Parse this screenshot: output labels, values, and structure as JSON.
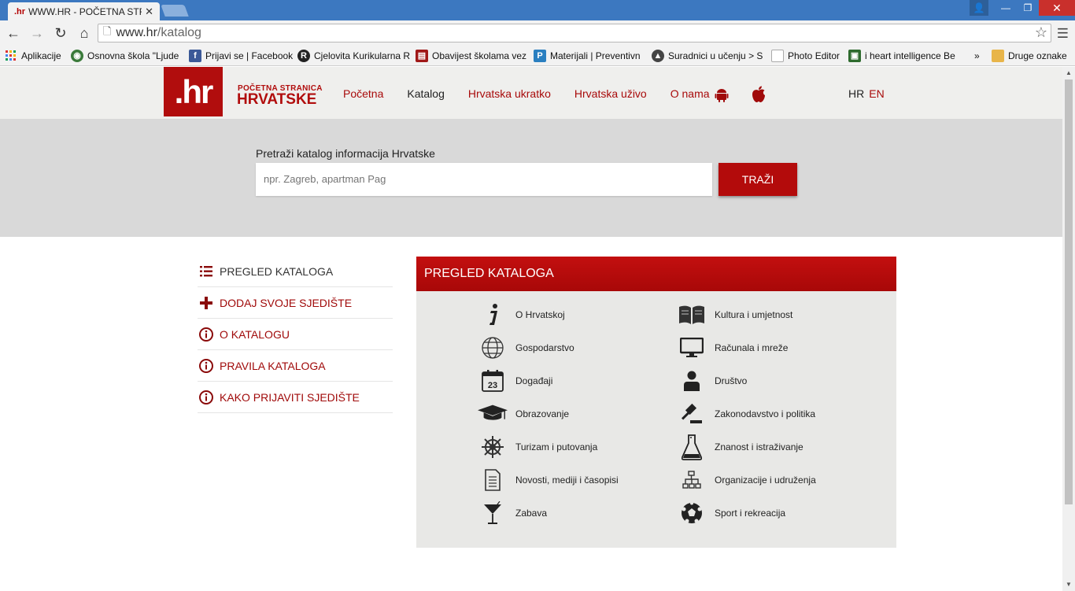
{
  "browser": {
    "tab_title": "WWW.HR - POČETNA STR",
    "tab_favicon": ".hr",
    "url_host": "www.hr",
    "url_path": "/katalog",
    "bookmarks": [
      {
        "label": "Aplikacije",
        "icon": "apps-grid-icon",
        "color": "#2b6ec8"
      },
      {
        "label": "Osnovna škola \"Ljude",
        "icon": "shield-icon",
        "color": "#3a7a3a"
      },
      {
        "label": "Prijavi se | Facebook",
        "icon": "facebook-icon",
        "color": "#3b5998"
      },
      {
        "label": "Cjelovita Kurikularna R",
        "icon": "r-logo-icon",
        "color": "#222222"
      },
      {
        "label": "Obavijest školama vez",
        "icon": "document-red-icon",
        "color": "#a01818"
      },
      {
        "label": "Materijali | Preventivn",
        "icon": "p-logo-icon",
        "color": "#2a7fc0"
      },
      {
        "label": "Suradnici u učenju > S",
        "icon": "graduation-icon",
        "color": "#444444"
      },
      {
        "label": "Photo Editor",
        "icon": "page-icon",
        "color": "#888888"
      },
      {
        "label": "i heart intelligence Be",
        "icon": "image-icon",
        "color": "#2e6b2e"
      }
    ],
    "more_bookmarks": "»",
    "other_bookmarks": "Druge oznake"
  },
  "header": {
    "logo_text": ".hr",
    "logo_small": "POČETNA STRANICA",
    "logo_big": "HRVATSKE",
    "nav": [
      "Početna",
      "Katalog",
      "Hrvatska ukratko",
      "Hrvatska uživo",
      "O nama"
    ],
    "lang_hr": "HR",
    "lang_en": "EN"
  },
  "search": {
    "label": "Pretraži katalog informacija Hrvatske",
    "placeholder": "npr. Zagreb, apartman Pag",
    "button": "TRAŽI"
  },
  "sidemenu": [
    {
      "label": "PREGLED KATALOGA",
      "icon": "list-icon"
    },
    {
      "label": "DODAJ SVOJE SJEDIŠTE",
      "icon": "plus-icon"
    },
    {
      "label": "O KATALOGU",
      "icon": "info-icon"
    },
    {
      "label": "PRAVILA KATALOGA",
      "icon": "info-icon"
    },
    {
      "label": "KAKO PRIJAVITI SJEDIŠTE",
      "icon": "info-icon"
    }
  ],
  "catalog": {
    "title": "PREGLED KATALOGA",
    "left": [
      {
        "label": "O Hrvatskoj",
        "icon": "info-italic-icon"
      },
      {
        "label": "Gospodarstvo",
        "icon": "globe-icon"
      },
      {
        "label": "Događaji",
        "icon": "calendar-icon",
        "badge": "23"
      },
      {
        "label": "Obrazovanje",
        "icon": "graduation-cap-icon"
      },
      {
        "label": "Turizam i putovanja",
        "icon": "ship-wheel-icon"
      },
      {
        "label": "Novosti, mediji i časopisi",
        "icon": "document-icon"
      },
      {
        "label": "Zabava",
        "icon": "cocktail-icon"
      }
    ],
    "right": [
      {
        "label": "Kultura i umjetnost",
        "icon": "book-icon"
      },
      {
        "label": "Računala i mreže",
        "icon": "monitor-icon"
      },
      {
        "label": "Društvo",
        "icon": "person-icon"
      },
      {
        "label": "Zakonodavstvo i politika",
        "icon": "gavel-icon"
      },
      {
        "label": "Znanost i istraživanje",
        "icon": "flask-icon"
      },
      {
        "label": "Organizacije i udruženja",
        "icon": "org-chart-icon"
      },
      {
        "label": "Sport i rekreacija",
        "icon": "soccer-ball-icon"
      }
    ]
  },
  "colors": {
    "brand_red": "#b10d0d",
    "hero_gray": "#d9d9d9",
    "header_gray": "#efefed"
  }
}
